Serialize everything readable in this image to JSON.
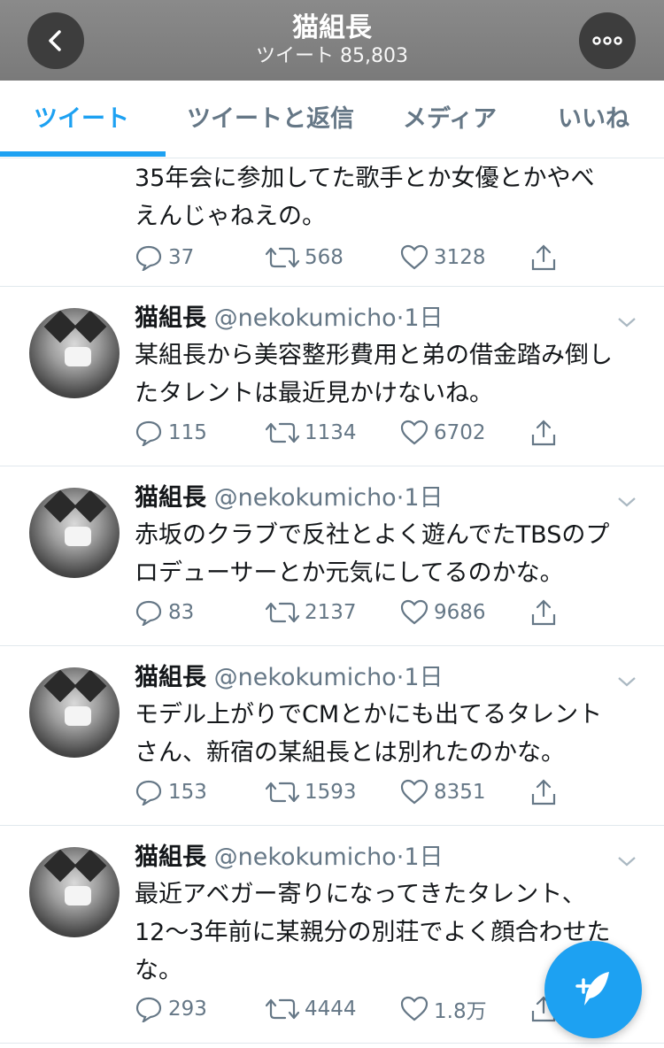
{
  "header": {
    "title": "猫組長",
    "subtitle": "ツイート 85,803",
    "back_icon": "chevron-left-icon",
    "more_icon": "more-dots-icon"
  },
  "tabs": [
    {
      "label": "ツイート",
      "active": true
    },
    {
      "label": "ツイートと返信",
      "active": false
    },
    {
      "label": "メディア",
      "active": false
    },
    {
      "label": "いいね",
      "active": false
    }
  ],
  "colors": {
    "accent": "#1da1f2",
    "secondary_text": "#657786",
    "divider": "#e1e8ed"
  },
  "tweets": [
    {
      "name": "",
      "handle": "",
      "time": "",
      "text_lines": [
        "35年会に参加してた歌手とか女優とかやべ",
        "えんじゃねえの。"
      ],
      "replies": "37",
      "retweets": "568",
      "likes": "3128"
    },
    {
      "name": "猫組長",
      "handle": "@nekokumicho",
      "time": "1日",
      "text_lines": [
        "某組長から美容整形費用と弟の借金踏み倒し",
        "たタレントは最近見かけないね。"
      ],
      "replies": "115",
      "retweets": "1134",
      "likes": "6702"
    },
    {
      "name": "猫組長",
      "handle": "@nekokumicho",
      "time": "1日",
      "text_lines": [
        "赤坂のクラブで反社とよく遊んでたTBSのプ",
        "ロデューサーとか元気にしてるのかな。"
      ],
      "replies": "83",
      "retweets": "2137",
      "likes": "9686"
    },
    {
      "name": "猫組長",
      "handle": "@nekokumicho",
      "time": "1日",
      "text_lines": [
        "モデル上がりでCMとかにも出てるタレント",
        "さん、新宿の某組長とは別れたのかな。"
      ],
      "replies": "153",
      "retweets": "1593",
      "likes": "8351"
    },
    {
      "name": "猫組長",
      "handle": "@nekokumicho",
      "time": "1日",
      "text_lines": [
        "最近アベガー寄りになってきたタレント、",
        "12〜3年前に某親分の別荘でよく顔合わせた",
        "な。"
      ],
      "replies": "293",
      "retweets": "4444",
      "likes": "1.8万"
    }
  ],
  "fab": {
    "icon": "compose-tweet-icon"
  }
}
